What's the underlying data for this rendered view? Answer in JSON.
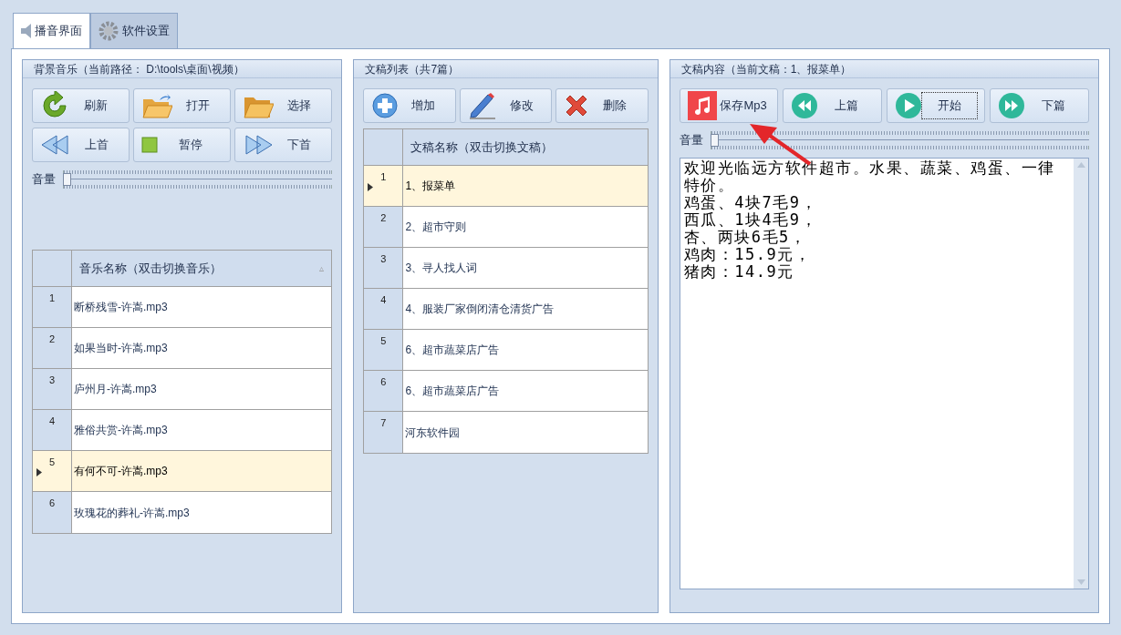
{
  "tabs": [
    {
      "label": "播音界面",
      "selected": true
    },
    {
      "label": "软件设置",
      "selected": false
    }
  ],
  "music_panel": {
    "title": "背景音乐（当前路径： D:\\tools\\桌面\\视频）",
    "buttons": [
      "刷新",
      "打开",
      "选择",
      "上首",
      "暂停",
      "下首"
    ],
    "volume": {
      "label": "音量",
      "level": 0
    },
    "table": {
      "column": "音乐名称（双击切换音乐）",
      "sort_indicator": "▵",
      "rows": [
        {
          "index": "1",
          "name": "断桥残雪-许嵩.mp3",
          "selected": false
        },
        {
          "index": "2",
          "name": "如果当时-许嵩.mp3",
          "selected": false
        },
        {
          "index": "3",
          "name": "庐州月-许嵩.mp3",
          "selected": false
        },
        {
          "index": "4",
          "name": "雅俗共赏-许嵩.mp3",
          "selected": false
        },
        {
          "index": "5",
          "name": "有何不可-许嵩.mp3",
          "selected": true
        },
        {
          "index": "6",
          "name": "玫瑰花的葬礼-许嵩.mp3",
          "selected": false
        }
      ]
    }
  },
  "script_panel": {
    "title": "文稿列表（共7篇）",
    "buttons": [
      "增加",
      "修改",
      "删除"
    ],
    "table": {
      "column": "文稿名称（双击切换文稿）",
      "rows": [
        {
          "index": "1",
          "name": "1、报菜单",
          "selected": true
        },
        {
          "index": "2",
          "name": "2、超市守则",
          "selected": false
        },
        {
          "index": "3",
          "name": "3、寻人找人词",
          "selected": false
        },
        {
          "index": "4",
          "name": "4、服装厂家倒闭清仓清货广告",
          "selected": false
        },
        {
          "index": "5",
          "name": "6、超市蔬菜店广告",
          "selected": false
        },
        {
          "index": "6",
          "name": "6、超市蔬菜店广告",
          "selected": false
        },
        {
          "index": "7",
          "name": "河东软件园",
          "selected": false
        }
      ]
    }
  },
  "content_panel": {
    "title": "文稿内容（当前文稿：1、报菜单）",
    "buttons": [
      {
        "label": "保存Mp3",
        "focused": false
      },
      {
        "label": "上篇",
        "focused": false
      },
      {
        "label": "开始",
        "focused": true
      },
      {
        "label": "下篇",
        "focused": false
      }
    ],
    "volume": {
      "label": "音量",
      "level": 0
    },
    "text_lines": [
      "欢迎光临远方软件超市。水果、蔬菜、鸡蛋、一律特价。",
      "鸡蛋、4块7毛9，",
      "西瓜、1块4毛9，",
      "杏、两块6毛5，",
      "鸡肉：15.9元，",
      "猪肉：14.9元"
    ]
  }
}
